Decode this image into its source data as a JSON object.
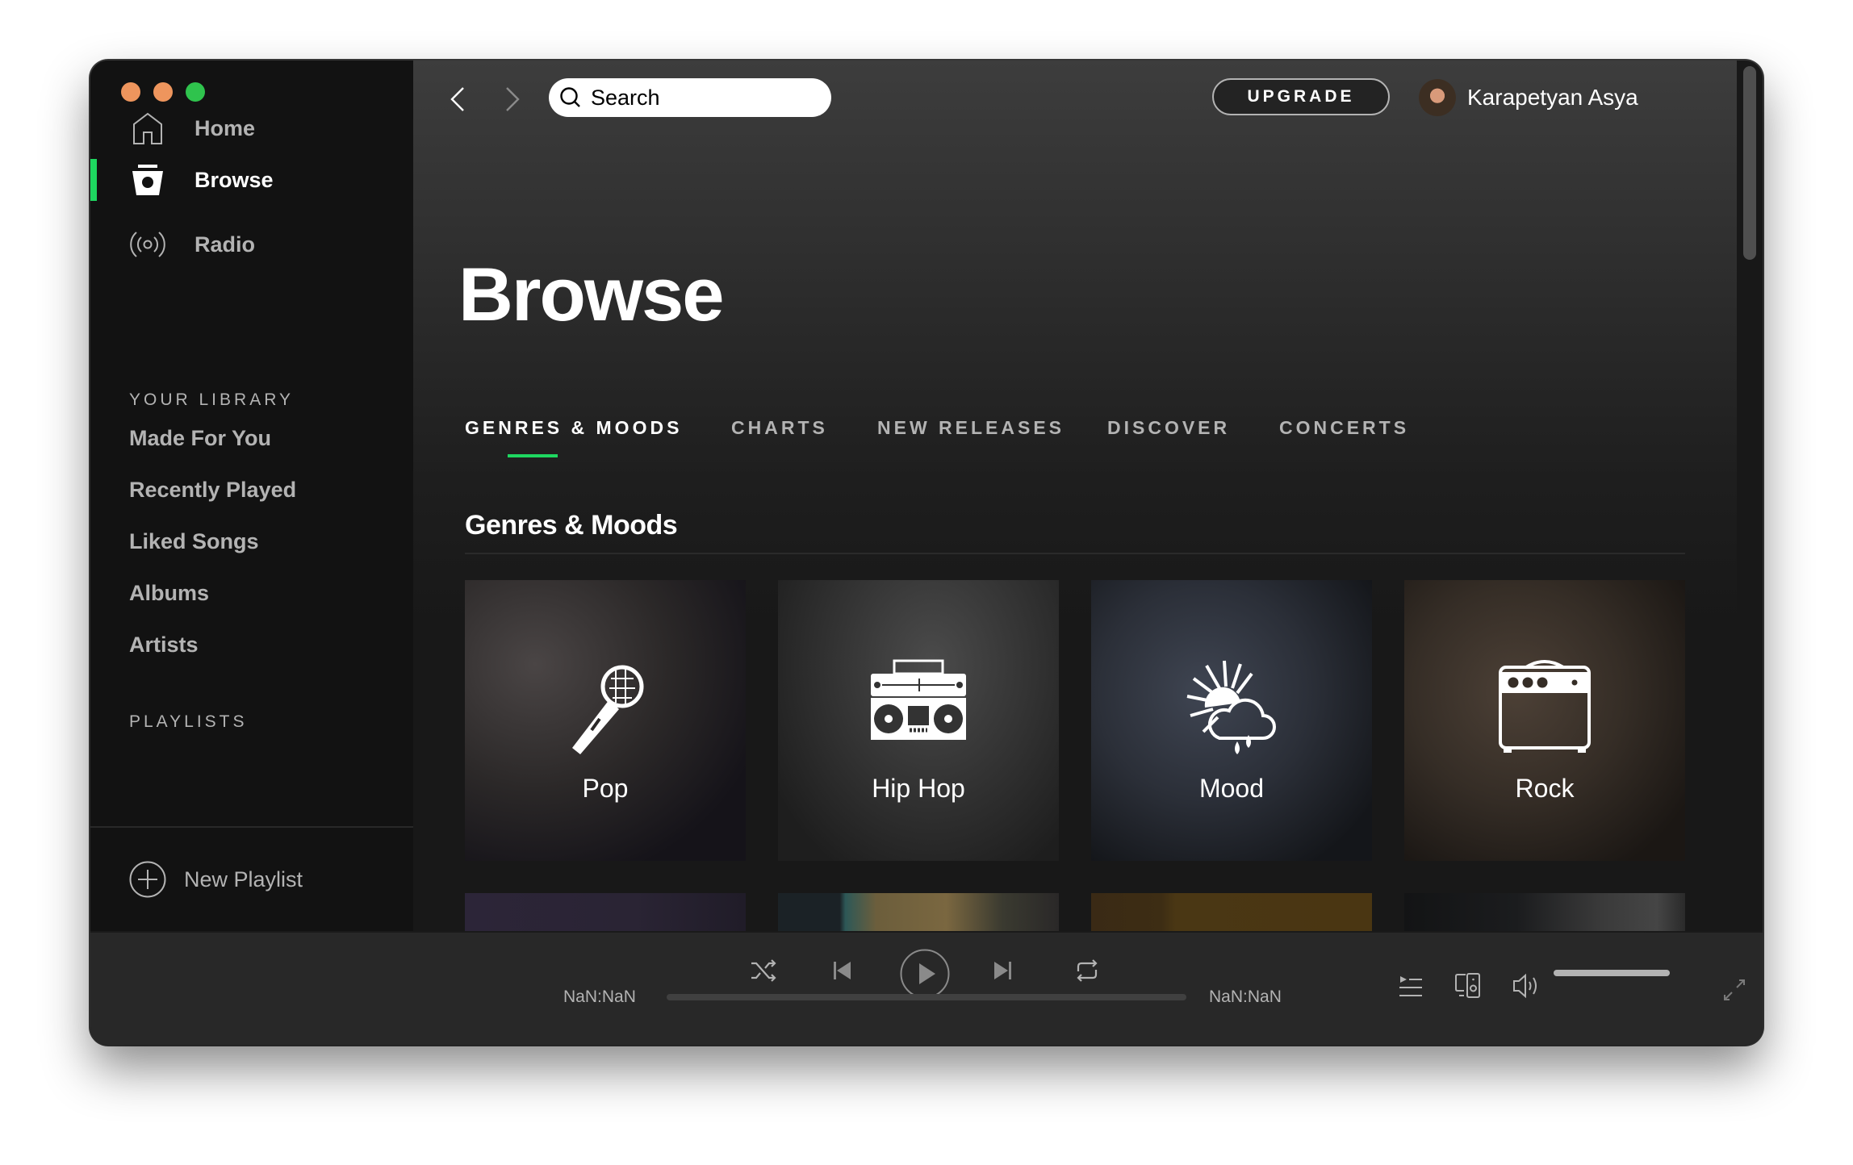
{
  "window": {
    "traffic_lights": [
      "close",
      "minimize",
      "maximize"
    ]
  },
  "sidebar": {
    "nav": [
      {
        "label": "Home",
        "icon": "home-icon",
        "active": false
      },
      {
        "label": "Browse",
        "icon": "browse-icon",
        "active": true
      },
      {
        "label": "Radio",
        "icon": "radio-icon",
        "active": false
      }
    ],
    "library_heading": "YOUR LIBRARY",
    "library_items": [
      "Made For You",
      "Recently Played",
      "Liked Songs",
      "Albums",
      "Artists"
    ],
    "playlists_heading": "PLAYLISTS",
    "new_playlist_label": "New Playlist"
  },
  "topbar": {
    "search_placeholder": "Search",
    "upgrade_label": "UPGRADE",
    "user_name": "Karapetyan Asya"
  },
  "main": {
    "title": "Browse",
    "tabs": [
      {
        "label": "GENRES & MOODS",
        "active": true
      },
      {
        "label": "CHARTS",
        "active": false
      },
      {
        "label": "NEW RELEASES",
        "active": false
      },
      {
        "label": "DISCOVER",
        "active": false
      },
      {
        "label": "CONCERTS",
        "active": false
      }
    ],
    "section_title": "Genres & Moods",
    "tiles": [
      {
        "label": "Pop",
        "icon": "microphone-icon"
      },
      {
        "label": "Hip Hop",
        "icon": "boombox-icon"
      },
      {
        "label": "Mood",
        "icon": "weather-icon"
      },
      {
        "label": "Rock",
        "icon": "amplifier-icon"
      }
    ]
  },
  "player": {
    "elapsed": "NaN:NaN",
    "duration": "NaN:NaN",
    "progress_fraction": 0,
    "volume_fraction": 1.0,
    "is_playing": false
  },
  "colors": {
    "accent": "#1ed760",
    "sidebar_bg": "#121212",
    "player_bg": "#282828",
    "traffic_close": "#ee955d",
    "traffic_min": "#ee955d",
    "traffic_max": "#2fc34d"
  }
}
